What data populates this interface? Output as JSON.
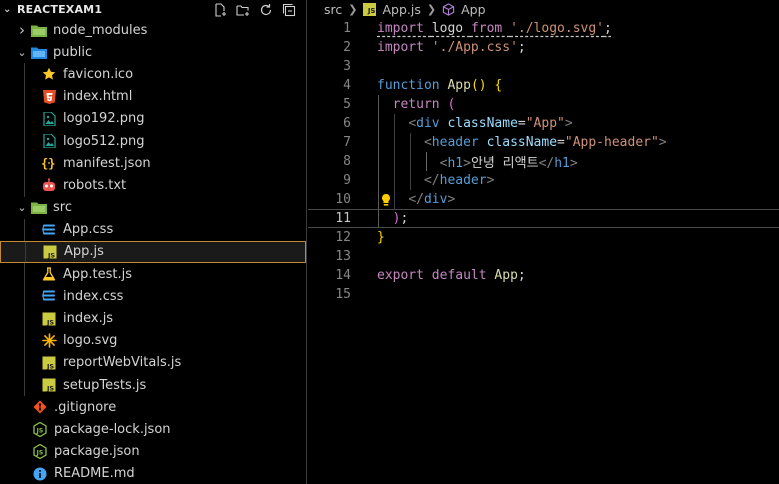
{
  "explorer": {
    "project": "REACTEXAM1",
    "items": [
      {
        "label": "node_modules",
        "kind": "folder",
        "expanded": false,
        "indent": 0,
        "icon": "folder-green-icon"
      },
      {
        "label": "public",
        "kind": "folder",
        "expanded": true,
        "indent": 0,
        "icon": "folder-blue-icon"
      },
      {
        "label": "favicon.ico",
        "kind": "file",
        "indent": 1,
        "icon": "star-icon"
      },
      {
        "label": "index.html",
        "kind": "file",
        "indent": 1,
        "icon": "html5-icon"
      },
      {
        "label": "logo192.png",
        "kind": "file",
        "indent": 1,
        "icon": "image-icon"
      },
      {
        "label": "logo512.png",
        "kind": "file",
        "indent": 1,
        "icon": "image-icon"
      },
      {
        "label": "manifest.json",
        "kind": "file",
        "indent": 1,
        "icon": "json-braces-icon"
      },
      {
        "label": "robots.txt",
        "kind": "file",
        "indent": 1,
        "icon": "robot-icon"
      },
      {
        "label": "src",
        "kind": "folder",
        "expanded": true,
        "indent": 0,
        "icon": "folder-green-icon"
      },
      {
        "label": "App.css",
        "kind": "file",
        "indent": 1,
        "icon": "css3-icon"
      },
      {
        "label": "App.js",
        "kind": "file",
        "indent": 1,
        "icon": "js-icon",
        "selected": true
      },
      {
        "label": "App.test.js",
        "kind": "file",
        "indent": 1,
        "icon": "flask-icon"
      },
      {
        "label": "index.css",
        "kind": "file",
        "indent": 1,
        "icon": "css3-icon"
      },
      {
        "label": "index.js",
        "kind": "file",
        "indent": 1,
        "icon": "js-icon"
      },
      {
        "label": "logo.svg",
        "kind": "file",
        "indent": 1,
        "icon": "svg-icon"
      },
      {
        "label": "reportWebVitals.js",
        "kind": "file",
        "indent": 1,
        "icon": "js-icon"
      },
      {
        "label": "setupTests.js",
        "kind": "file",
        "indent": 1,
        "icon": "js-icon"
      },
      {
        "label": ".gitignore",
        "kind": "file",
        "indent": 0,
        "icon": "git-icon"
      },
      {
        "label": "package-lock.json",
        "kind": "file",
        "indent": 0,
        "icon": "nodejs-icon"
      },
      {
        "label": "package.json",
        "kind": "file",
        "indent": 0,
        "icon": "nodejs-icon"
      },
      {
        "label": "README.md",
        "kind": "file",
        "indent": 0,
        "icon": "info-icon"
      }
    ]
  },
  "breadcrumb": {
    "folder": "src",
    "file": "App.js",
    "symbol": "App",
    "file_badge": "JS"
  },
  "editor": {
    "current_line": 11,
    "lines": [
      {
        "n": "1",
        "tokens": [
          [
            "kw2",
            "import "
          ],
          [
            "plain",
            "logo "
          ],
          [
            "kw2",
            "from "
          ],
          [
            "str",
            "'./logo.svg'"
          ],
          [
            "plain",
            ";"
          ]
        ]
      },
      {
        "n": "2",
        "tokens": [
          [
            "kw2",
            "import "
          ],
          [
            "str",
            "'./App.css'"
          ],
          [
            "plain",
            ";"
          ]
        ]
      },
      {
        "n": "3",
        "tokens": []
      },
      {
        "n": "4",
        "tokens": [
          [
            "kw",
            "function "
          ],
          [
            "fn",
            "App"
          ],
          [
            "br1",
            "()"
          ],
          [
            "plain",
            " "
          ],
          [
            "br1",
            "{"
          ]
        ]
      },
      {
        "n": "5",
        "tokens": [
          [
            "plain",
            "  "
          ],
          [
            "kw2",
            "return "
          ],
          [
            "br2",
            "("
          ]
        ]
      },
      {
        "n": "6",
        "tokens": [
          [
            "plain",
            "    "
          ],
          [
            "punc",
            "<"
          ],
          [
            "tag",
            "div "
          ],
          [
            "attr",
            "className"
          ],
          [
            "plain",
            "="
          ],
          [
            "str",
            "\"App\""
          ],
          [
            "punc",
            ">"
          ]
        ]
      },
      {
        "n": "7",
        "tokens": [
          [
            "plain",
            "      "
          ],
          [
            "punc",
            "<"
          ],
          [
            "tag",
            "header "
          ],
          [
            "attr",
            "className"
          ],
          [
            "plain",
            "="
          ],
          [
            "str",
            "\"App-header\""
          ],
          [
            "punc",
            ">"
          ]
        ]
      },
      {
        "n": "8",
        "tokens": [
          [
            "plain",
            "        "
          ],
          [
            "punc",
            "<"
          ],
          [
            "tag",
            "h1"
          ],
          [
            "punc",
            ">"
          ],
          [
            "plain",
            "안녕 리액트"
          ],
          [
            "punc",
            "</"
          ],
          [
            "tag",
            "h1"
          ],
          [
            "punc",
            ">"
          ]
        ]
      },
      {
        "n": "9",
        "tokens": [
          [
            "plain",
            "      "
          ],
          [
            "punc",
            "</"
          ],
          [
            "tag",
            "header"
          ],
          [
            "punc",
            ">"
          ]
        ]
      },
      {
        "n": "10",
        "tokens": [
          [
            "plain",
            "    "
          ],
          [
            "punc",
            "</"
          ],
          [
            "tag",
            "div"
          ],
          [
            "punc",
            ">"
          ]
        ]
      },
      {
        "n": "11",
        "tokens": [
          [
            "plain",
            "  "
          ],
          [
            "br2",
            ")"
          ],
          [
            "plain",
            ";"
          ]
        ]
      },
      {
        "n": "12",
        "tokens": [
          [
            "br1",
            "}"
          ]
        ]
      },
      {
        "n": "13",
        "tokens": []
      },
      {
        "n": "14",
        "tokens": [
          [
            "kw2",
            "export "
          ],
          [
            "kw2",
            "default "
          ],
          [
            "fn",
            "App"
          ],
          [
            "plain",
            ";"
          ]
        ]
      },
      {
        "n": "15",
        "tokens": []
      }
    ]
  },
  "colors": {
    "selection_border": "#c48a2f",
    "js_badge": "#cbcb41",
    "folder_green": "#8bc34a",
    "folder_blue": "#42a5f5"
  }
}
